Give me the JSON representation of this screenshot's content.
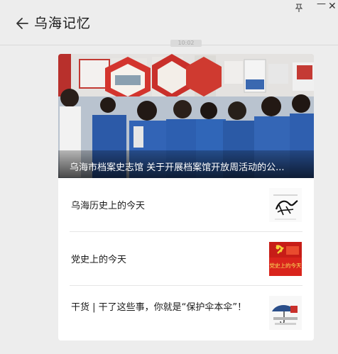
{
  "window": {
    "title": "乌海记忆",
    "pin_icon": "pin-icon",
    "minimize_label": "—",
    "close_label": "✕"
  },
  "message": {
    "time": "10:02"
  },
  "article_card": {
    "lead": {
      "title": "乌海市档案史志馆 关于开展档案馆开放周活动的公..."
    },
    "items": [
      {
        "title": "乌海历史上的今天"
      },
      {
        "title": "党史上的今天"
      },
      {
        "title": "干货 | 干了这些事，你就是“保护伞本伞”！"
      }
    ],
    "thumb_texts": {
      "party": "党史上的今天"
    }
  }
}
